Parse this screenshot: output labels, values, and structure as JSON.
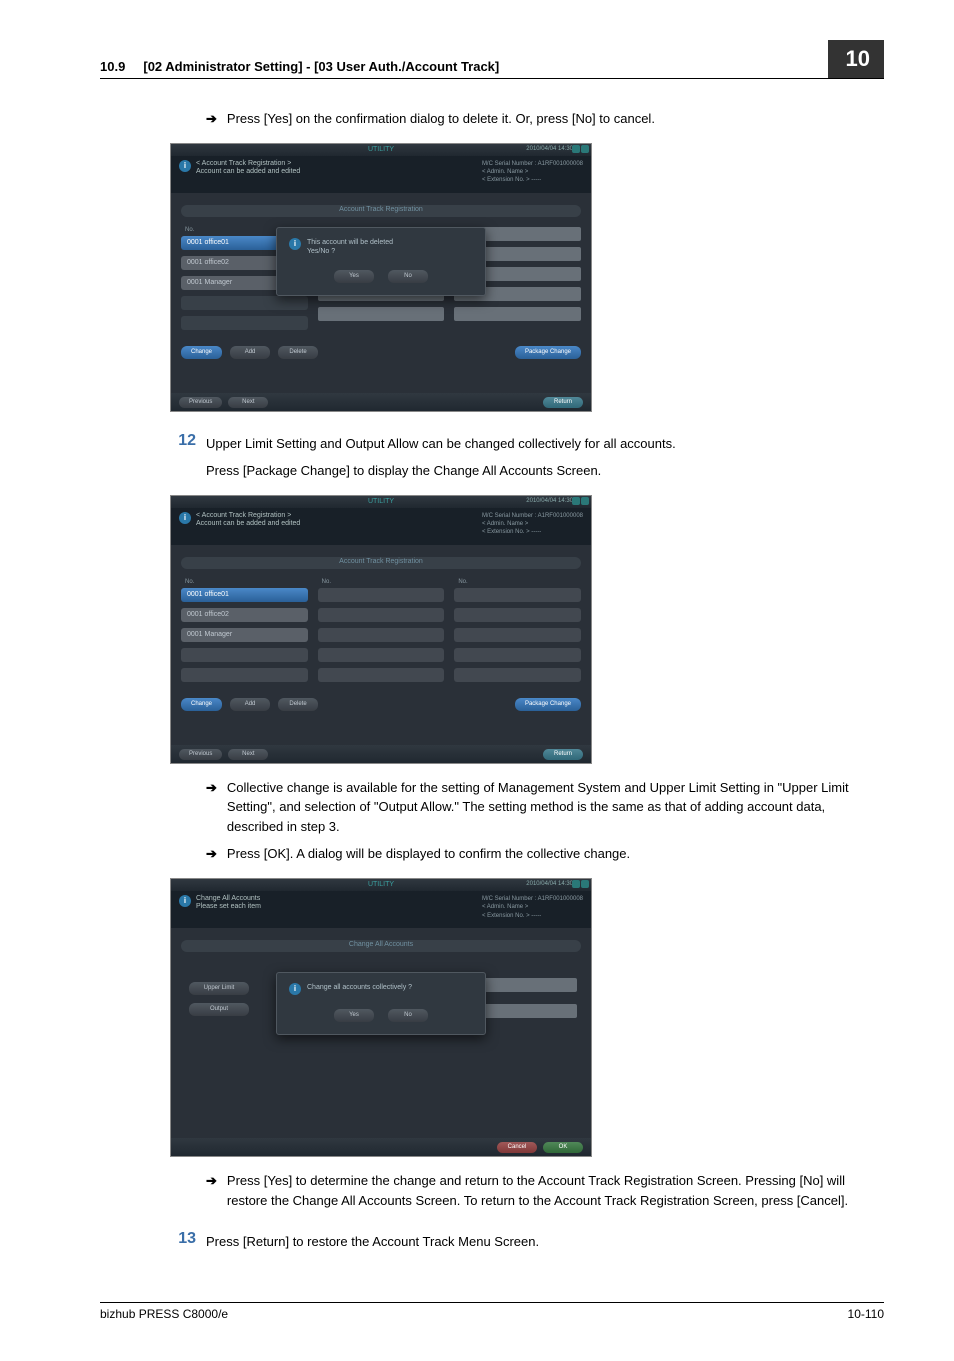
{
  "header": {
    "section_num": "10.9",
    "section_title": "[02 Administrator Setting] - [03 User Auth./Account Track]",
    "chapter": "10"
  },
  "step11": {
    "bullet1": "Press [Yes] on the confirmation dialog to delete it. Or, press [No] to cancel."
  },
  "step12": {
    "num": "12",
    "text": "Upper Limit Setting and Output Allow can be changed collectively for all accounts.",
    "sub": "Press [Package Change] to display the Change All Accounts Screen.",
    "bullet1": "Collective change is available for the setting of Management System and Upper Limit Setting in \"Upper Limit Setting\", and selection of \"Output Allow.\" The setting method is the same as that of adding account data, described in step 3.",
    "bullet2": "Press [OK]. A dialog will be displayed to confirm the collective change.",
    "bullet3": "Press [Yes] to determine the change and return to the Account Track Registration Screen. Pressing [No] will restore the Change All Accounts Screen. To return to the Account Track Registration Screen, press [Cancel]."
  },
  "step13": {
    "num": "13",
    "text": "Press [Return] to restore the Account Track Menu Screen."
  },
  "footer": {
    "left": "bizhub PRESS C8000/e",
    "right": "10-110"
  },
  "ss_common": {
    "utility": "UTILITY",
    "datetime": "2010/04/04 14:30",
    "meta_serial": "M/C Serial Number : A1RF001000008",
    "meta_admin": "< Admin. Name >",
    "meta_ext": "< Extension No. > -----",
    "tab_reg": "Account Track Registration",
    "no_label": "No.",
    "btn_change": "Change",
    "btn_add": "Add",
    "btn_delete": "Delete",
    "btn_package": "Package Change",
    "btn_previous": "Previous",
    "btn_next": "Next",
    "btn_return": "Return",
    "btn_yes": "Yes",
    "btn_no": "No",
    "btn_cancel": "Cancel",
    "btn_ok": "OK"
  },
  "ss1": {
    "title_line1": "< Account Track Registration >",
    "title_line2": "Account can be added and edited",
    "item1": "0001 office01",
    "item2": "0001 office02",
    "item3": "0001 Manager",
    "dialog_line1": "This account will be deleted",
    "dialog_line2": "Yes/No ?"
  },
  "ss2": {
    "title_line1": "< Account Track Registration >",
    "title_line2": "Account can be added and edited",
    "item1": "0001 office01",
    "item2": "0001 office02",
    "item3": "0001 Manager"
  },
  "ss3": {
    "title_line1": "Change All Accounts",
    "title_line2": "Please set each item",
    "tab_change": "Change All Accounts",
    "btn_upper": "Upper Limit",
    "btn_output": "Output",
    "dialog_line": "Change all accounts collectively ?"
  }
}
